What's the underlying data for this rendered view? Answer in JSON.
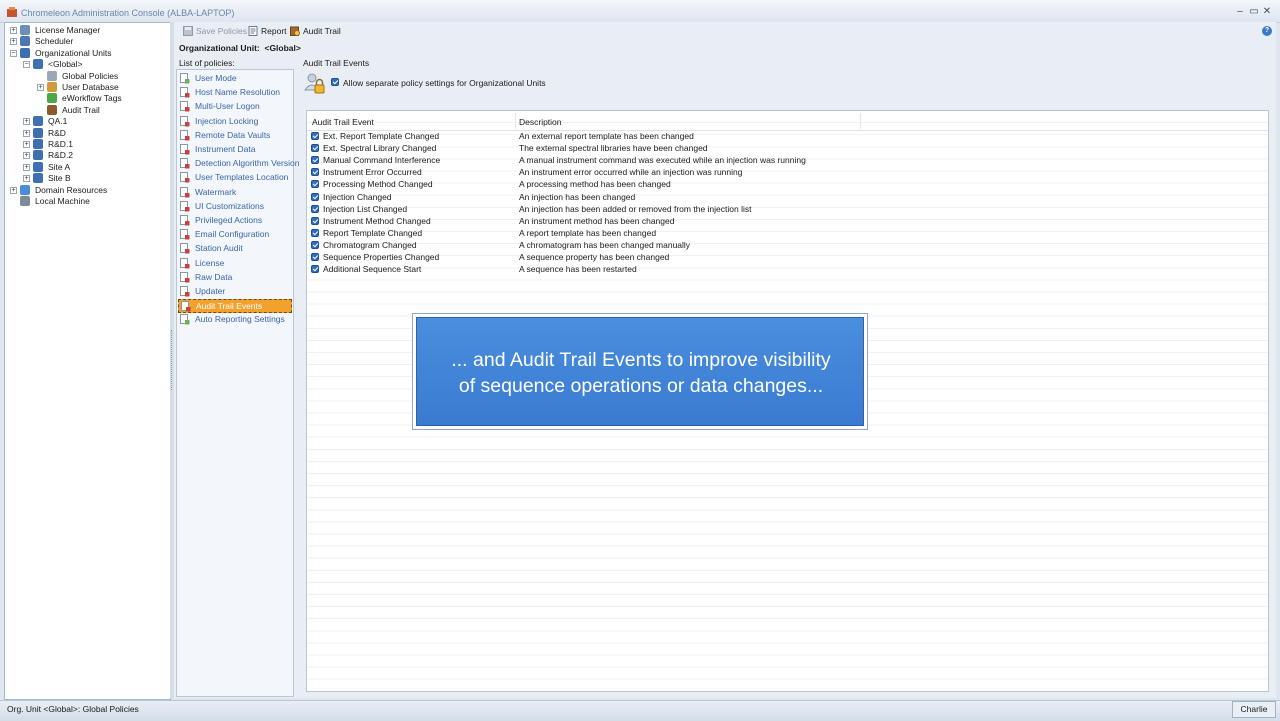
{
  "window": {
    "title": "Chromeleon Administration Console (ALBA-LAPTOP)",
    "minimize": "–",
    "restore": "▭",
    "close": "✕"
  },
  "tree": {
    "items": [
      {
        "label": "License Manager",
        "expander": "+"
      },
      {
        "label": "Scheduler",
        "expander": "+"
      },
      {
        "label": "Organizational Units",
        "expander": "−"
      },
      {
        "label": "<Global>",
        "expander": "−"
      },
      {
        "label": "Global Policies",
        "expander": ""
      },
      {
        "label": "User Database",
        "expander": "+"
      },
      {
        "label": "eWorkflow Tags",
        "expander": ""
      },
      {
        "label": "Audit Trail",
        "expander": ""
      },
      {
        "label": "QA.1",
        "expander": "+"
      },
      {
        "label": "R&D",
        "expander": "+"
      },
      {
        "label": "R&D.1",
        "expander": "+"
      },
      {
        "label": "R&D.2",
        "expander": "+"
      },
      {
        "label": "Site A",
        "expander": "+"
      },
      {
        "label": "Site B",
        "expander": "+"
      },
      {
        "label": "Domain Resources",
        "expander": "+"
      },
      {
        "label": "Local Machine",
        "expander": ""
      }
    ]
  },
  "toolbar": {
    "save_label": "Save Policies",
    "report_label": "Report",
    "audit_label": "Audit Trail"
  },
  "org_unit": {
    "label": "Organizational Unit:",
    "value": "<Global>"
  },
  "policies": {
    "header": "List of policies:",
    "items": [
      "User Mode",
      "Host Name Resolution",
      "Multi-User Logon",
      "Injection Locking",
      "Remote Data Vaults",
      "Instrument Data",
      "Detection Algorithm Version",
      "User Templates Location",
      "Watermark",
      "UI Customizations",
      "Privileged Actions",
      "Email Configuration",
      "Station Audit",
      "License",
      "Raw Data",
      "Updater",
      "Audit Trail Events",
      "Auto Reporting Settings"
    ],
    "selected": "Audit Trail Events"
  },
  "panel": {
    "title": "Audit Trail Events",
    "allow_label": "Allow separate policy settings for Organizational Units",
    "allow_checked": true
  },
  "grid": {
    "col_event": "Audit Trail Event",
    "col_desc": "Description",
    "rows": [
      {
        "event": "Ext. Report Template Changed",
        "desc": "An external report template has been changed"
      },
      {
        "event": "Ext. Spectral Library Changed",
        "desc": "The external spectral libraries have been changed"
      },
      {
        "event": "Manual Command Interference",
        "desc": "A manual instrument command was executed while an injection was running"
      },
      {
        "event": "Instrument Error Occurred",
        "desc": "An instrument error occurred while an injection was running"
      },
      {
        "event": "Processing Method Changed",
        "desc": "A processing method has been changed"
      },
      {
        "event": "Injection Changed",
        "desc": "An injection has been changed"
      },
      {
        "event": "Injection List Changed",
        "desc": "An injection has been added or removed from the injection list"
      },
      {
        "event": "Instrument Method Changed",
        "desc": "An instrument method has been changed"
      },
      {
        "event": "Report Template Changed",
        "desc": "A report template has been changed"
      },
      {
        "event": "Chromatogram Changed",
        "desc": "A chromatogram has been changed manually"
      },
      {
        "event": "Sequence Properties Changed",
        "desc": "A sequence property has been changed"
      },
      {
        "event": "Additional Sequence Start",
        "desc": "A sequence has been restarted"
      }
    ]
  },
  "callout": {
    "line1": "... and Audit Trail Events to improve visibility",
    "line2": "of sequence operations or data changes..."
  },
  "status": {
    "text": "Org. Unit <Global>: Global Policies",
    "user": "Charlie"
  },
  "colors": {
    "accent": "#3a7bd0",
    "selected": "#f2a12c",
    "link": "#3a66a8"
  }
}
